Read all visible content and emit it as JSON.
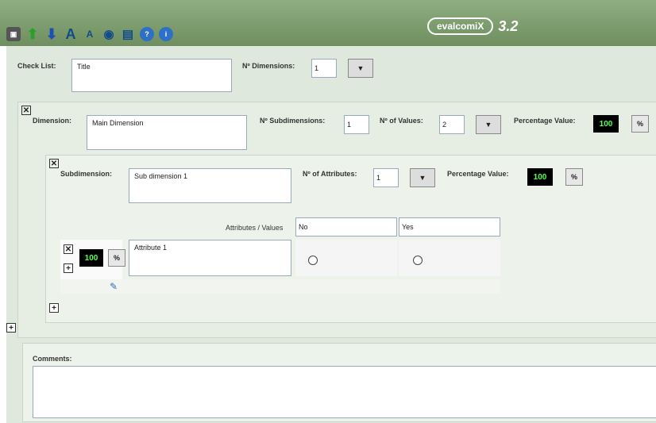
{
  "app": {
    "name_logo": "evalcomiX",
    "version": "3.2"
  },
  "toolbar": {
    "icons": [
      "save-icon",
      "arrow-up-icon",
      "arrow-down-icon",
      "text-large-icon",
      "text-small-icon",
      "eye-icon",
      "print-icon",
      "help-icon",
      "info-icon"
    ]
  },
  "checklist": {
    "label": "Check List:",
    "title_value": "Title",
    "dimensions_label": "Nº Dimensions:",
    "dimensions_value": "1"
  },
  "dimension": {
    "label": "Dimension:",
    "name_value": "Main Dimension",
    "subdimensions_label": "Nº Subdimensions:",
    "subdimensions_value": "1",
    "values_label": "Nº of Values:",
    "values_value": "2",
    "percentage_label": "Percentage Value:",
    "percentage_value": "100",
    "percent_button": "%"
  },
  "subdimension": {
    "label": "Subdimension:",
    "name_value": "Sub dimension 1",
    "attributes_label": "Nº of Attributes:",
    "attributes_value": "1",
    "percentage_label": "Percentage Value:",
    "percentage_value": "100",
    "percent_button": "%"
  },
  "attributes": {
    "header_label": "Attributes / Values",
    "values": [
      "No",
      "Yes"
    ],
    "rows": [
      {
        "percentage": "100",
        "percent_button": "%",
        "name": "Attribute 1"
      }
    ]
  },
  "comments": {
    "label": "Comments:",
    "value": ""
  }
}
